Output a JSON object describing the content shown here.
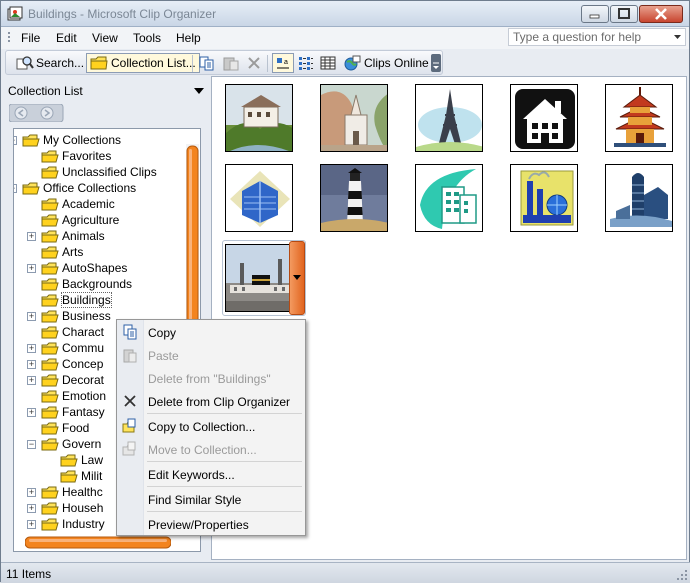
{
  "window": {
    "title": "Buildings - Microsoft Clip Organizer"
  },
  "menu": [
    "File",
    "Edit",
    "View",
    "Tools",
    "Help"
  ],
  "help_placeholder": "Type a question for help",
  "toolbar": {
    "search": "Search...",
    "collection_list": "Collection List...",
    "clips_online": "Clips Online"
  },
  "left": {
    "header": "Collection List",
    "tree": [
      {
        "label": "My Collections",
        "level": 0,
        "expanded": true
      },
      {
        "label": "Favorites",
        "level": 1
      },
      {
        "label": "Unclassified Clips",
        "level": 1
      },
      {
        "label": "Office Collections",
        "level": 0,
        "expanded": true
      },
      {
        "label": "Academic",
        "level": 1
      },
      {
        "label": "Agriculture",
        "level": 1
      },
      {
        "label": "Animals",
        "level": 1,
        "expandable": true
      },
      {
        "label": "Arts",
        "level": 1
      },
      {
        "label": "AutoShapes",
        "level": 1,
        "expandable": true
      },
      {
        "label": "Backgrounds",
        "level": 1
      },
      {
        "label": "Buildings",
        "level": 1,
        "selected": true
      },
      {
        "label": "Business",
        "level": 1,
        "expandable": true
      },
      {
        "label": "Charact",
        "level": 1
      },
      {
        "label": "Commu",
        "level": 1,
        "expandable": true
      },
      {
        "label": "Concep",
        "level": 1,
        "expandable": true
      },
      {
        "label": "Decorat",
        "level": 1,
        "expandable": true
      },
      {
        "label": "Emotion",
        "level": 1
      },
      {
        "label": "Fantasy",
        "level": 1,
        "expandable": true
      },
      {
        "label": "Food",
        "level": 1
      },
      {
        "label": "Govern",
        "level": 1,
        "expanded": true
      },
      {
        "label": "Law",
        "level": 2
      },
      {
        "label": "Milit",
        "level": 2
      },
      {
        "label": "Healthc",
        "level": 1,
        "expandable": true
      },
      {
        "label": "Househ",
        "level": 1,
        "expandable": true
      },
      {
        "label": "Industry",
        "level": 1,
        "expandable": true
      }
    ]
  },
  "clips": [
    "Mansion",
    "Church",
    "Eiffel Tower",
    "House",
    "Pagoda",
    "Office Tower",
    "Lighthouse",
    "City Building",
    "Factory",
    "Silo Barn",
    "Mosque"
  ],
  "context_menu": [
    {
      "label": "Copy",
      "enabled": true,
      "icon": "copy-icon"
    },
    {
      "label": "Paste",
      "enabled": false,
      "icon": "paste-icon"
    },
    {
      "label": "Delete from \"Buildings\"",
      "enabled": false
    },
    {
      "label": "Delete from Clip Organizer",
      "enabled": true,
      "icon": "delete-x-icon"
    },
    {
      "label": "Copy to Collection...",
      "enabled": true,
      "icon": "copy-to-collection-icon"
    },
    {
      "label": "Move to Collection...",
      "enabled": false,
      "icon": "move-to-collection-icon"
    },
    {
      "label": "Edit Keywords...",
      "enabled": true
    },
    {
      "label": "Find Similar Style",
      "enabled": true
    },
    {
      "label": "Preview/Properties",
      "enabled": true
    }
  ],
  "status": "11 Items",
  "colors": {
    "accent": "#f3841f",
    "titlebar": "#c9d6e6",
    "folder": "#ffe35a"
  }
}
